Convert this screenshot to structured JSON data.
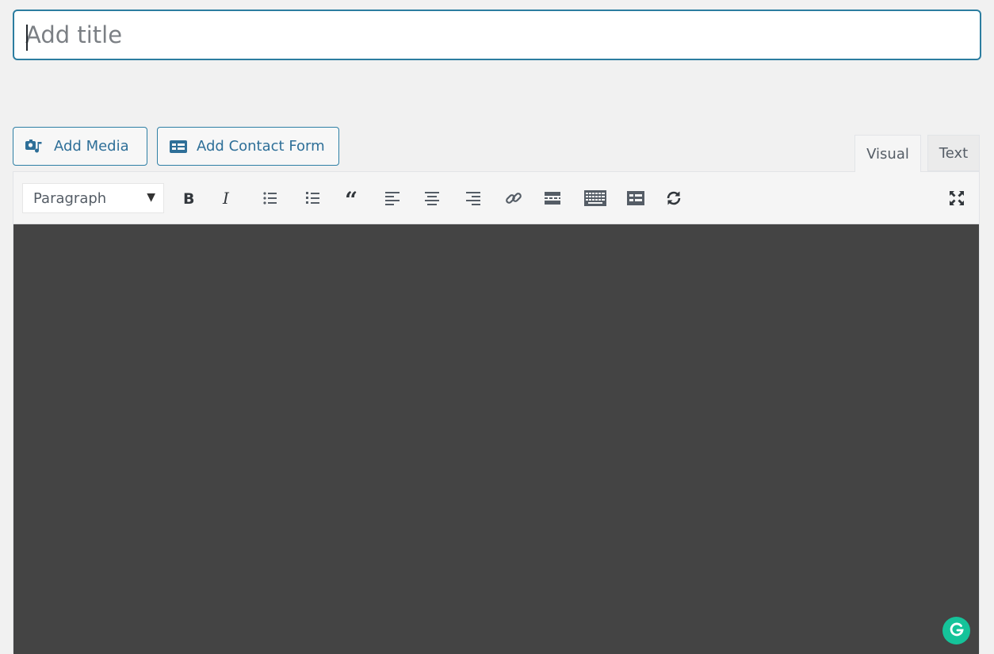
{
  "title_field": {
    "placeholder": "Add title",
    "value": ""
  },
  "buttons": {
    "add_media": "Add Media",
    "add_contact_form": "Add Contact Form"
  },
  "tabs": {
    "visual": "Visual",
    "text": "Text",
    "active": "Visual"
  },
  "toolbar": {
    "format_value": "Paragraph",
    "format_options": [
      "Paragraph"
    ],
    "tools": [
      "bold-icon",
      "italic-icon",
      "bulleted-list-icon",
      "numbered-list-icon",
      "blockquote-icon",
      "align-left-icon",
      "align-center-icon",
      "align-right-icon",
      "link-icon",
      "read-more-icon",
      "toolbar-toggle-icon",
      "contact-form-icon",
      "refresh-icon",
      "fullscreen-icon"
    ]
  },
  "editor": {
    "content": "",
    "background_color": "#444444"
  },
  "extensions": {
    "grammarly_icon": "grammarly-icon"
  },
  "colors": {
    "accent": "#2e7fa5",
    "grammarly": "#15c39a"
  }
}
